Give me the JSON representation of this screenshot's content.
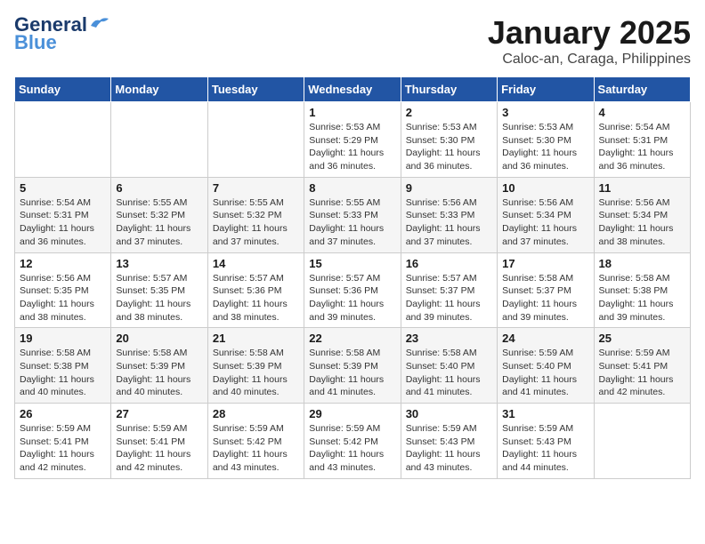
{
  "header": {
    "logo_line1": "General",
    "logo_line2": "Blue",
    "title": "January 2025",
    "subtitle": "Caloc-an, Caraga, Philippines"
  },
  "days_of_week": [
    "Sunday",
    "Monday",
    "Tuesday",
    "Wednesday",
    "Thursday",
    "Friday",
    "Saturday"
  ],
  "weeks": [
    [
      {
        "day": "",
        "info": ""
      },
      {
        "day": "",
        "info": ""
      },
      {
        "day": "",
        "info": ""
      },
      {
        "day": "1",
        "info": "Sunrise: 5:53 AM\nSunset: 5:29 PM\nDaylight: 11 hours\nand 36 minutes."
      },
      {
        "day": "2",
        "info": "Sunrise: 5:53 AM\nSunset: 5:30 PM\nDaylight: 11 hours\nand 36 minutes."
      },
      {
        "day": "3",
        "info": "Sunrise: 5:53 AM\nSunset: 5:30 PM\nDaylight: 11 hours\nand 36 minutes."
      },
      {
        "day": "4",
        "info": "Sunrise: 5:54 AM\nSunset: 5:31 PM\nDaylight: 11 hours\nand 36 minutes."
      }
    ],
    [
      {
        "day": "5",
        "info": "Sunrise: 5:54 AM\nSunset: 5:31 PM\nDaylight: 11 hours\nand 36 minutes."
      },
      {
        "day": "6",
        "info": "Sunrise: 5:55 AM\nSunset: 5:32 PM\nDaylight: 11 hours\nand 37 minutes."
      },
      {
        "day": "7",
        "info": "Sunrise: 5:55 AM\nSunset: 5:32 PM\nDaylight: 11 hours\nand 37 minutes."
      },
      {
        "day": "8",
        "info": "Sunrise: 5:55 AM\nSunset: 5:33 PM\nDaylight: 11 hours\nand 37 minutes."
      },
      {
        "day": "9",
        "info": "Sunrise: 5:56 AM\nSunset: 5:33 PM\nDaylight: 11 hours\nand 37 minutes."
      },
      {
        "day": "10",
        "info": "Sunrise: 5:56 AM\nSunset: 5:34 PM\nDaylight: 11 hours\nand 37 minutes."
      },
      {
        "day": "11",
        "info": "Sunrise: 5:56 AM\nSunset: 5:34 PM\nDaylight: 11 hours\nand 38 minutes."
      }
    ],
    [
      {
        "day": "12",
        "info": "Sunrise: 5:56 AM\nSunset: 5:35 PM\nDaylight: 11 hours\nand 38 minutes."
      },
      {
        "day": "13",
        "info": "Sunrise: 5:57 AM\nSunset: 5:35 PM\nDaylight: 11 hours\nand 38 minutes."
      },
      {
        "day": "14",
        "info": "Sunrise: 5:57 AM\nSunset: 5:36 PM\nDaylight: 11 hours\nand 38 minutes."
      },
      {
        "day": "15",
        "info": "Sunrise: 5:57 AM\nSunset: 5:36 PM\nDaylight: 11 hours\nand 39 minutes."
      },
      {
        "day": "16",
        "info": "Sunrise: 5:57 AM\nSunset: 5:37 PM\nDaylight: 11 hours\nand 39 minutes."
      },
      {
        "day": "17",
        "info": "Sunrise: 5:58 AM\nSunset: 5:37 PM\nDaylight: 11 hours\nand 39 minutes."
      },
      {
        "day": "18",
        "info": "Sunrise: 5:58 AM\nSunset: 5:38 PM\nDaylight: 11 hours\nand 39 minutes."
      }
    ],
    [
      {
        "day": "19",
        "info": "Sunrise: 5:58 AM\nSunset: 5:38 PM\nDaylight: 11 hours\nand 40 minutes."
      },
      {
        "day": "20",
        "info": "Sunrise: 5:58 AM\nSunset: 5:39 PM\nDaylight: 11 hours\nand 40 minutes."
      },
      {
        "day": "21",
        "info": "Sunrise: 5:58 AM\nSunset: 5:39 PM\nDaylight: 11 hours\nand 40 minutes."
      },
      {
        "day": "22",
        "info": "Sunrise: 5:58 AM\nSunset: 5:39 PM\nDaylight: 11 hours\nand 41 minutes."
      },
      {
        "day": "23",
        "info": "Sunrise: 5:58 AM\nSunset: 5:40 PM\nDaylight: 11 hours\nand 41 minutes."
      },
      {
        "day": "24",
        "info": "Sunrise: 5:59 AM\nSunset: 5:40 PM\nDaylight: 11 hours\nand 41 minutes."
      },
      {
        "day": "25",
        "info": "Sunrise: 5:59 AM\nSunset: 5:41 PM\nDaylight: 11 hours\nand 42 minutes."
      }
    ],
    [
      {
        "day": "26",
        "info": "Sunrise: 5:59 AM\nSunset: 5:41 PM\nDaylight: 11 hours\nand 42 minutes."
      },
      {
        "day": "27",
        "info": "Sunrise: 5:59 AM\nSunset: 5:41 PM\nDaylight: 11 hours\nand 42 minutes."
      },
      {
        "day": "28",
        "info": "Sunrise: 5:59 AM\nSunset: 5:42 PM\nDaylight: 11 hours\nand 43 minutes."
      },
      {
        "day": "29",
        "info": "Sunrise: 5:59 AM\nSunset: 5:42 PM\nDaylight: 11 hours\nand 43 minutes."
      },
      {
        "day": "30",
        "info": "Sunrise: 5:59 AM\nSunset: 5:43 PM\nDaylight: 11 hours\nand 43 minutes."
      },
      {
        "day": "31",
        "info": "Sunrise: 5:59 AM\nSunset: 5:43 PM\nDaylight: 11 hours\nand 44 minutes."
      },
      {
        "day": "",
        "info": ""
      }
    ]
  ]
}
